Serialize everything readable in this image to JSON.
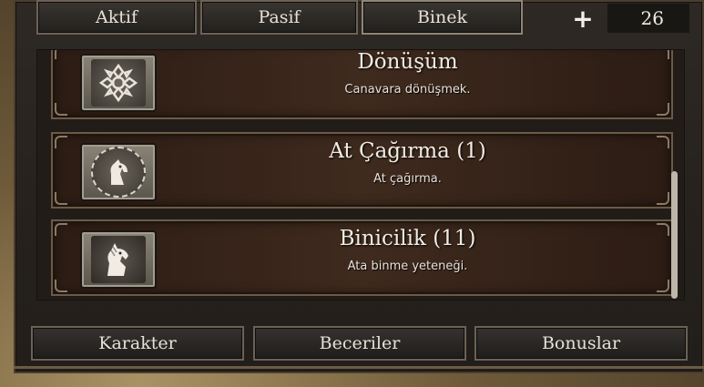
{
  "tabs": {
    "active": "Aktif",
    "passive": "Pasif",
    "mount": "Binek"
  },
  "skill_points": {
    "plus_symbol": "+",
    "value": "26"
  },
  "skills": [
    {
      "name": "Dönüşüm",
      "description": "Canavara dönüşmek.",
      "icon": "transformation-knot-icon"
    },
    {
      "name": "At Çağırma (1)",
      "description": "At çağırma.",
      "icon": "horse-call-icon"
    },
    {
      "name": "Binicilik (11)",
      "description": "Ata binme yeteneği.",
      "icon": "horse-riding-icon"
    }
  ],
  "bottom_tabs": {
    "character": "Karakter",
    "skills": "Beceriler",
    "bonuses": "Bonuslar"
  }
}
